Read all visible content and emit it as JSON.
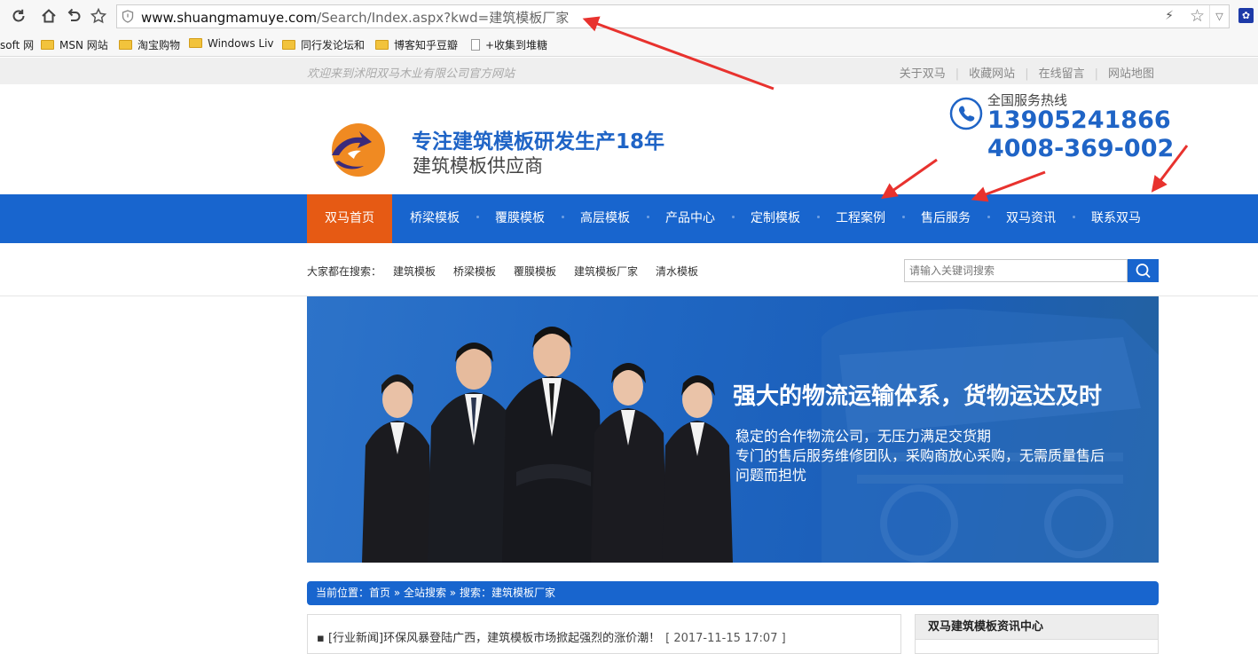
{
  "browser": {
    "url_host": "www.shuangmamuye.com",
    "url_path": "/Search/Index.aspx?kwd=建筑模板厂家",
    "bookmarks": [
      {
        "label": "soft 网",
        "type": "text"
      },
      {
        "label": "MSN 网站",
        "type": "folder"
      },
      {
        "label": "淘宝购物",
        "type": "folder"
      },
      {
        "label": "Windows Liv",
        "type": "folder"
      },
      {
        "label": "同行发论坛和",
        "type": "folder"
      },
      {
        "label": "博客知乎豆瓣",
        "type": "folder"
      },
      {
        "label": "+收集到堆糖",
        "type": "page"
      }
    ],
    "icons": {
      "reload": "reload-icon",
      "home": "home-icon",
      "back": "undo-icon",
      "bookmark": "star-icon",
      "security": "shield-icon",
      "extension": "paw-icon"
    }
  },
  "top_strip": {
    "welcome": "欢迎来到沭阳双马木业有限公司官方网站",
    "links": [
      "关于双马",
      "收藏网站",
      "在线留言",
      "网站地图"
    ]
  },
  "header": {
    "slogan_main": "专注建筑模板研发生产18年",
    "slogan_sub": "建筑模板供应商",
    "hotline_label": "全国服务热线",
    "hotline_1": "13905241866",
    "hotline_2": "4008-369-002"
  },
  "nav": {
    "items": [
      "双马首页",
      "桥梁模板",
      "覆膜模板",
      "高层模板",
      "产品中心",
      "定制模板",
      "工程案例",
      "售后服务",
      "双马资讯",
      "联系双马"
    ],
    "active_index": 0
  },
  "search": {
    "hot_label": "大家都在搜索：",
    "hot_keywords": [
      "建筑模板",
      "桥梁模板",
      "覆膜模板",
      "建筑模板厂家",
      "清水模板"
    ],
    "placeholder": "请输入关键词搜索"
  },
  "banner": {
    "title": "强大的物流运输体系，货物运达及时",
    "lines": [
      "稳定的合作物流公司，无压力满足交货期",
      "专门的售后服务维修团队，采购商放心采购，无需质量售后",
      "问题而担忧"
    ]
  },
  "breadcrumb": {
    "text": "当前位置：首页 » 全站搜索 » 搜索：建筑模板厂家"
  },
  "results": [
    {
      "title": "[行业新闻]环保风暴登陆广西，建筑模板市场掀起强烈的涨价潮！",
      "date": "[ 2017-11-15 17:07 ]"
    }
  ],
  "sidebar": {
    "title": "双马建筑模板资讯中心"
  },
  "colors": {
    "brand_blue": "#1865ce",
    "active_orange": "#e65a14",
    "annotation_red": "#e8322e"
  }
}
